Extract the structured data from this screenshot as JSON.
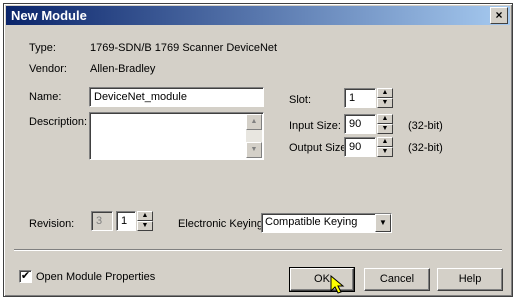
{
  "window": {
    "title": "New Module",
    "close_glyph": "×"
  },
  "module": {
    "type_label": "Type:",
    "type_value": "1769-SDN/B 1769 Scanner DeviceNet",
    "vendor_label": "Vendor:",
    "vendor_value": "Allen-Bradley",
    "name_label": "Name:",
    "name_value": "DeviceNet_module",
    "description_label": "Description:",
    "description_value": ""
  },
  "slot": {
    "label": "Slot:",
    "value": "1"
  },
  "input_size": {
    "label": "Input Size:",
    "value": "90",
    "unit": "(32-bit)"
  },
  "output_size": {
    "label": "Output Size:",
    "value": "90",
    "unit": "(32-bit)"
  },
  "revision": {
    "label": "Revision:",
    "major": "3",
    "minor": "1"
  },
  "keying": {
    "label": "Electronic Keying:",
    "selected": "Compatible Keying"
  },
  "open_properties": {
    "label": "Open Module Properties",
    "checked": true,
    "check_glyph": "✔"
  },
  "buttons": {
    "ok": "OK",
    "cancel": "Cancel",
    "help": "Help"
  },
  "icons": {
    "up": "▲",
    "down": "▼"
  }
}
